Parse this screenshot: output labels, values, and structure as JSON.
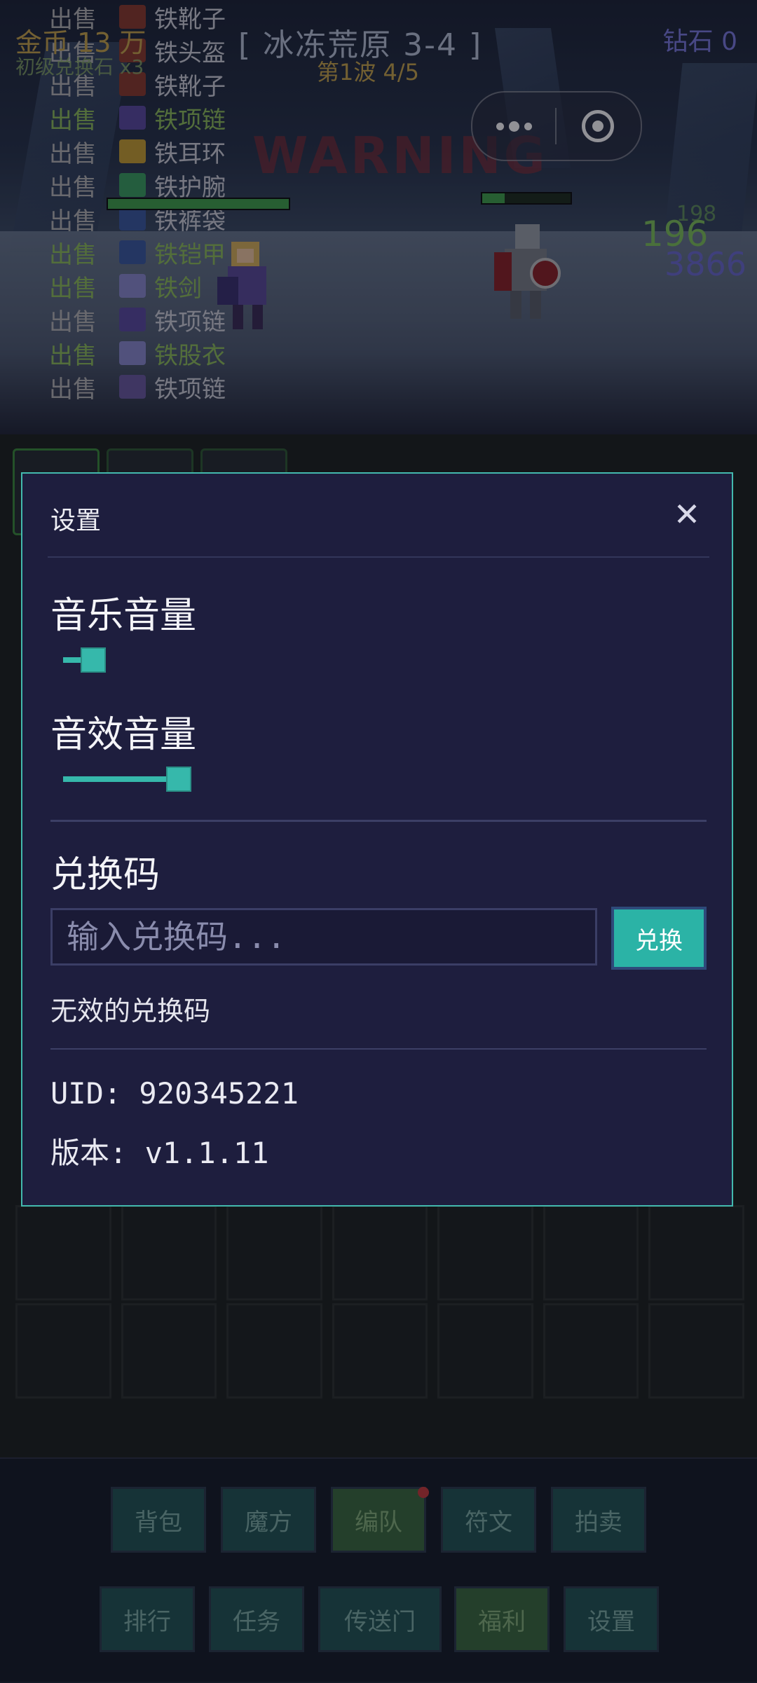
{
  "hud": {
    "gold": "金币 13 万",
    "sub": "初级兑换石 x3",
    "stage": "[ 冰冻荒原 3-4 ]",
    "wave": "第1波 4/5",
    "diamond": "钻石 0",
    "warning": "WARNING"
  },
  "battle_log": [
    {
      "action": "出售",
      "item": "铁靴子",
      "green": false
    },
    {
      "action": "出售",
      "item": "铁头盔",
      "green": false
    },
    {
      "action": "出售",
      "item": "铁靴子",
      "green": false
    },
    {
      "action": "出售",
      "item": "铁项链",
      "green": true
    },
    {
      "action": "出售",
      "item": "铁耳环",
      "green": false
    },
    {
      "action": "出售",
      "item": "铁护腕",
      "green": false
    },
    {
      "action": "出售",
      "item": "铁裤袋",
      "green": false
    },
    {
      "action": "出售",
      "item": "铁铠甲",
      "green": true
    },
    {
      "action": "出售",
      "item": "铁剑",
      "green": true
    },
    {
      "action": "出售",
      "item": "铁项链",
      "green": false
    },
    {
      "action": "出售",
      "item": "铁股衣",
      "green": true
    },
    {
      "action": "出售",
      "item": "铁项链",
      "green": false
    }
  ],
  "damage": {
    "a": "196",
    "b": "3866",
    "c": "198"
  },
  "bottom_nav": {
    "row1": [
      "背包",
      "魔方",
      "编队",
      "符文",
      "拍卖"
    ],
    "row2": [
      "排行",
      "任务",
      "传送门",
      "福利",
      "设置"
    ]
  },
  "settings": {
    "title": "设置",
    "music_label": "音乐音量",
    "music_volume": 0.3,
    "sfx_label": "音效音量",
    "sfx_volume": 0.92,
    "redeem_label": "兑换码",
    "redeem_placeholder": "输入兑换码...",
    "redeem_button": "兑换",
    "redeem_message": "无效的兑换码",
    "uid_line": "UID: 920345221",
    "version_line": "版本: v1.1.11"
  },
  "icons": {
    "close": "close-icon",
    "more": "more-dots-icon",
    "target": "target-icon"
  },
  "colors": {
    "accent": "#36b8ab",
    "modal_bg": "#1e1e3e",
    "modal_border": "#43b9ae"
  }
}
